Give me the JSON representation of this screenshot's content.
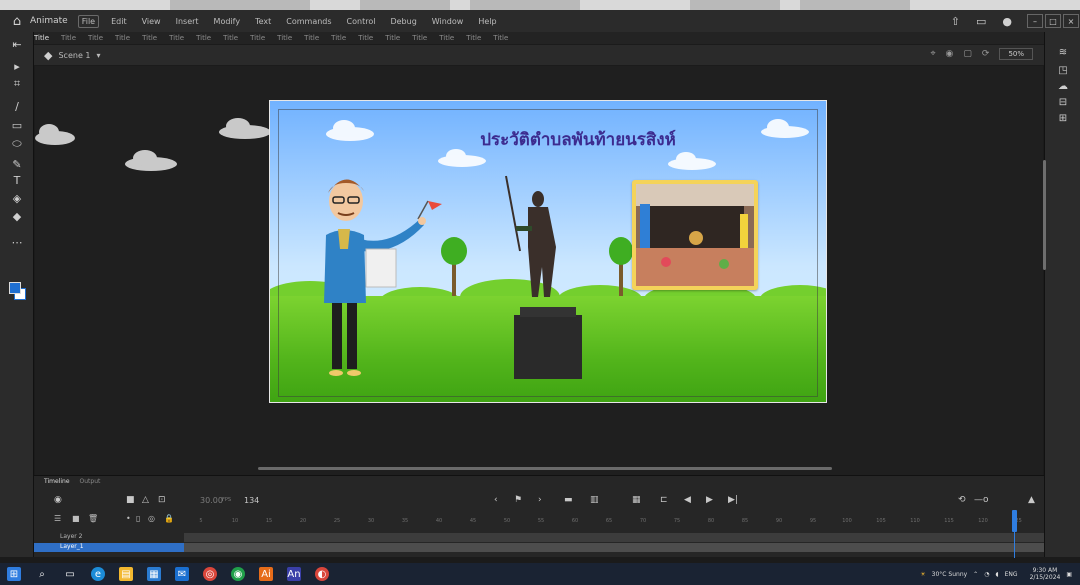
{
  "menubar": {
    "app_name": "Animate",
    "items": [
      "File",
      "Edit",
      "View",
      "Insert",
      "Modify",
      "Text",
      "Commands",
      "Control",
      "Debug",
      "Window",
      "Help"
    ],
    "window_buttons": [
      "–",
      "□",
      "×"
    ]
  },
  "tabs": [
    "Title",
    "Title",
    "Title",
    "Title",
    "Title",
    "Title",
    "Title",
    "Title",
    "Title",
    "Title",
    "Title",
    "Title",
    "Title",
    "Title",
    "Title",
    "Title",
    "Title",
    "Title"
  ],
  "editbar": {
    "scene_label": "Scene 1",
    "zoom": "50%"
  },
  "stage": {
    "title": "ประวัติตำบลพันท้ายนรสิงห์"
  },
  "timeline": {
    "tabs": [
      "Timeline",
      "Output"
    ],
    "fps": "30.00",
    "fps_unit": "FPS",
    "frame": "134",
    "ruler": [
      "5",
      "10",
      "15",
      "20",
      "25",
      "30",
      "35",
      "40",
      "45",
      "50",
      "55",
      "60",
      "65",
      "70",
      "75",
      "80",
      "85",
      "90",
      "95",
      "100",
      "105",
      "110",
      "115",
      "120",
      "125"
    ],
    "layers": [
      "Layer 2",
      "Layer_1"
    ]
  },
  "taskbar": {
    "weather": "30°C Sunny",
    "language": "ENG",
    "time": "9:30 AM",
    "date": "2/15/2024"
  }
}
